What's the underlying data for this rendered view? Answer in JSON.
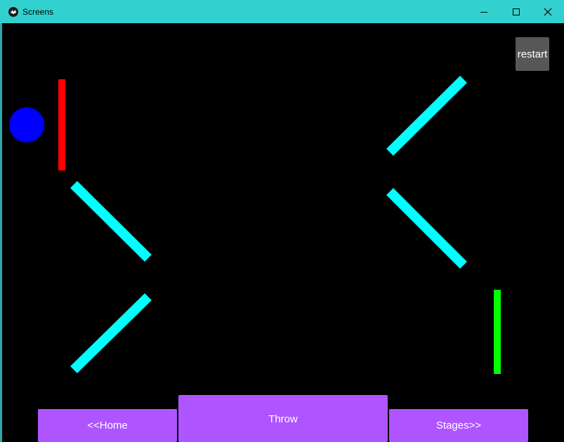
{
  "window": {
    "title": "Screens",
    "title_bar_color": "#33d0d0",
    "icon": "kivy-app-icon"
  },
  "controls": {
    "restart_label": "restart",
    "home_label": "<<Home",
    "throw_label": "Throw",
    "stages_label": "Stages>>"
  },
  "colors": {
    "background": "#000000",
    "ball": "#0000ff",
    "start_bar": "#ff0000",
    "goal_bar": "#00ff00",
    "deflectors": "#00ffff",
    "buttons": "#ae55ff",
    "restart_button": "#575757"
  },
  "game_objects": {
    "ball": "blue-circle",
    "start_bar": "red-vertical-bar",
    "goal_bar": "green-vertical-bar",
    "deflector_count": 4
  }
}
